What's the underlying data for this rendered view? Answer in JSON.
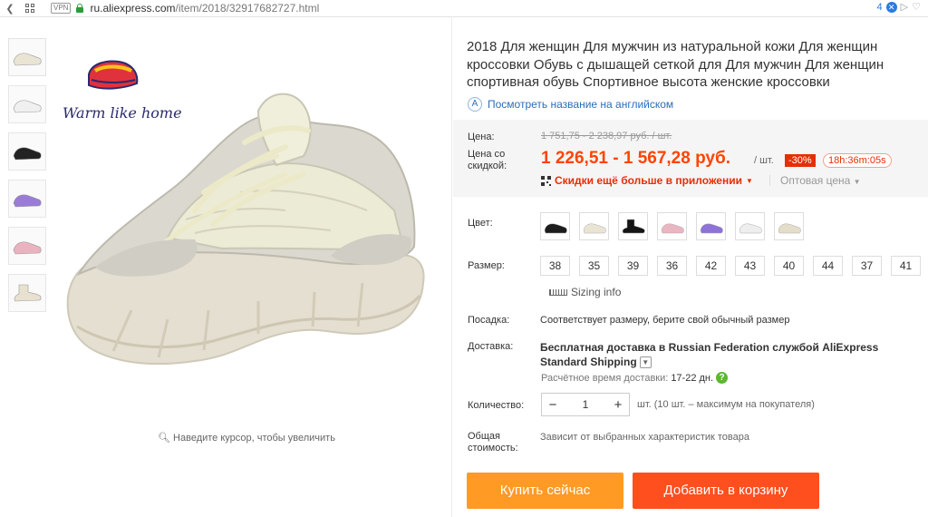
{
  "browser": {
    "vpn_label": "VPN",
    "url_domain": "ru.aliexpress.com",
    "url_path": "/item/2018/32917682727.html",
    "tab_count": "4"
  },
  "gallery": {
    "logo_text": "Warm like home",
    "zoom_hint": "Наведите курсор, чтобы увеличить",
    "thumbnail_colors": [
      "#e9e4d3",
      "#f0f0f0",
      "#222222",
      "#9a7cd6",
      "#eab3c0",
      "#e8e1cf"
    ]
  },
  "product": {
    "title": "2018 Для женщин Для мужчин из натуральной кожи Для женщин кроссовки Обувь с дышащей сеткой для Для мужчин Для женщин спортивная обувь Спортивное высота женские кроссовки",
    "translate_link": "Посмотреть название на английском"
  },
  "price": {
    "label_price": "Цена:",
    "old_price": "1 751,75 - 2 238,97 руб. / шт.",
    "label_discount_line1": "Цена со",
    "label_discount_line2": "скидкой:",
    "new_price": "1 226,51 - 1 567,28 руб.",
    "per_unit": "/ шт.",
    "discount_badge": "-30%",
    "timer": "18h:36m:05s",
    "app_promo": "Скидки ещё больше в приложении",
    "wholesale": "Оптовая цена"
  },
  "options": {
    "color_label": "Цвет:",
    "color_swatches": [
      "#1c1c1c",
      "#e9e4d3",
      "#151515",
      "#eab6c2",
      "#8e72d8",
      "#eeeeee",
      "#e3ddc9"
    ],
    "size_label": "Размер:",
    "sizes": [
      "38",
      "35",
      "39",
      "36",
      "42",
      "43",
      "40",
      "44",
      "37",
      "41"
    ],
    "sizing_info": "Sizing info",
    "fit_label": "Посадка:",
    "fit_value": "Соответствует размеру, берите свой обычный размер"
  },
  "shipping": {
    "label": "Доставка:",
    "line1": "Бесплатная доставка в Russian Federation службой AliExpress Standard Shipping",
    "estimate_label": "Расчётное время доставки:",
    "estimate_value": "17-22 дн."
  },
  "quantity": {
    "label": "Количество:",
    "minus": "−",
    "value": "1",
    "plus": "+",
    "note": "шт. (10 шт. – максимум на покупателя)"
  },
  "total": {
    "label_line1": "Общая",
    "label_line2": "стоимость:",
    "value": "Зависит от выбранных характеристик товара"
  },
  "actions": {
    "buy_now": "Купить сейчас",
    "add_to_cart": "Добавить в корзину"
  }
}
